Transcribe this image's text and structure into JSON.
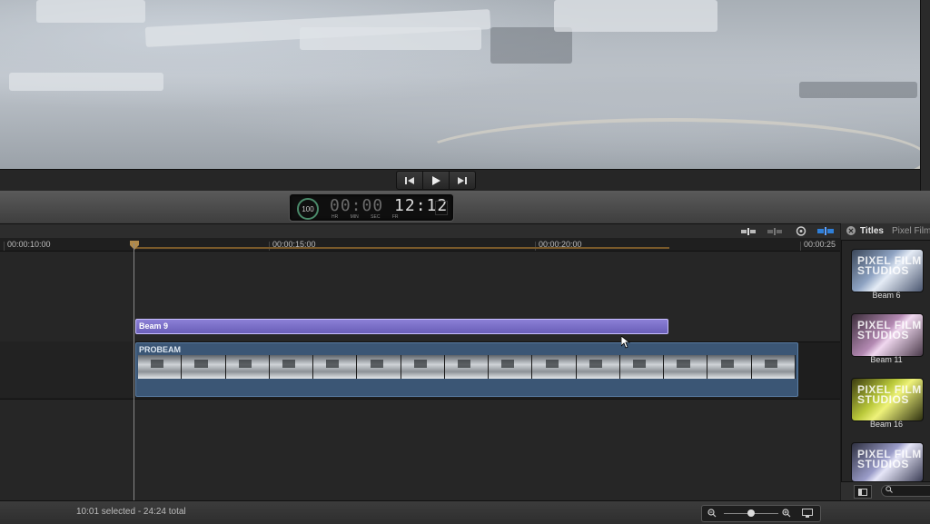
{
  "viewer": {
    "description_icon": "footage-frame"
  },
  "transport": {
    "prev_icon": "skip-back-icon",
    "play_icon": "play-icon",
    "next_icon": "skip-forward-icon"
  },
  "timecode": {
    "percent": "100",
    "hours_minutes": "00:00",
    "seconds_frames": "12:12",
    "units": "HR MIN SEC FR"
  },
  "ruler": {
    "labels": [
      "00:00:10:00",
      "00:00:15:00",
      "00:00:20:00",
      "00:00:25"
    ]
  },
  "clips": {
    "title_clip": "Beam 9",
    "video_clip": "PROBEAM"
  },
  "status": {
    "selection": "10:01 selected - 24:24 total"
  },
  "browser": {
    "title": "Titles",
    "subtitle": "Pixel Film",
    "items": [
      {
        "label": "Beam 6",
        "brand": "PIXEL FILM STUDIOS"
      },
      {
        "label": "Beam 11",
        "brand": "PIXEL FILM STUDIOS"
      },
      {
        "label": "Beam 16",
        "brand": "PIXEL FILM STUDIOS"
      },
      {
        "label": "",
        "brand": "PIXEL FILM STUDIOS"
      }
    ]
  },
  "colors": {
    "title_clip": "#7c71c9",
    "video_clip": "#3b5675",
    "accent_blue": "#2f7fd8"
  }
}
